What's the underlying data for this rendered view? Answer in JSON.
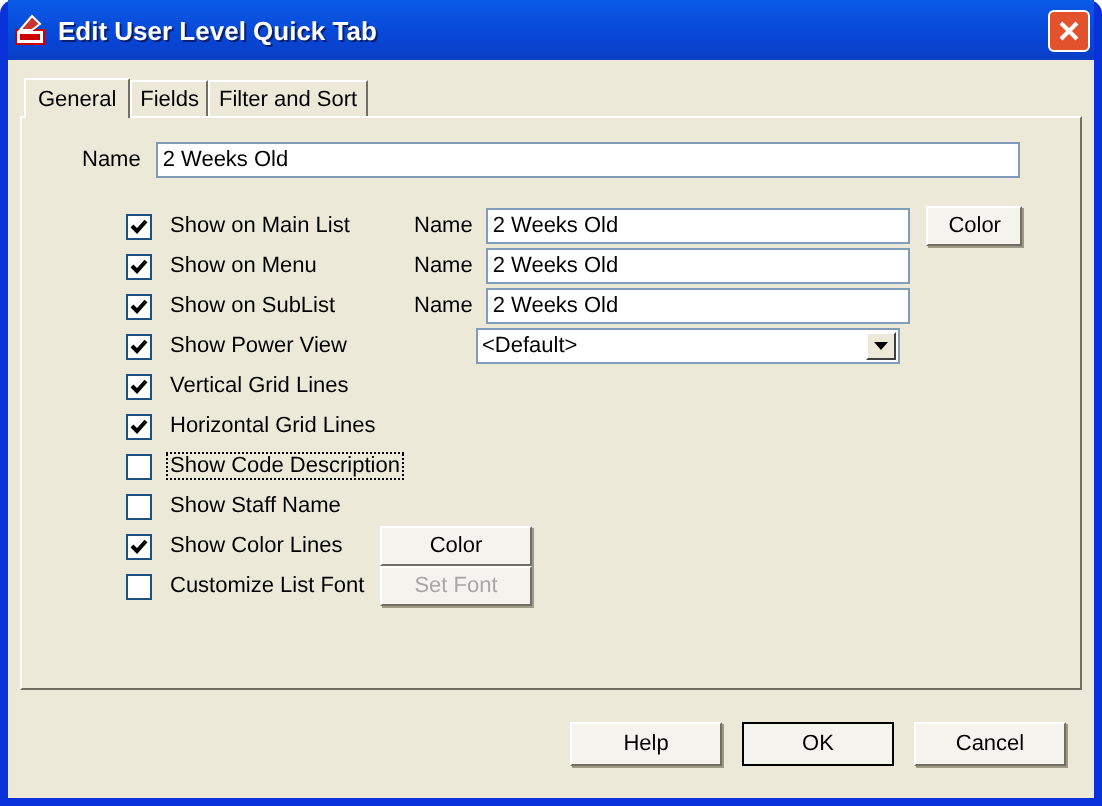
{
  "window": {
    "title": "Edit User Level Quick Tab"
  },
  "tabs": [
    {
      "label": "General",
      "selected": true
    },
    {
      "label": "Fields",
      "selected": false
    },
    {
      "label": "Filter and Sort",
      "selected": false
    }
  ],
  "name_field": {
    "label": "Name",
    "value": "2 Weeks Old"
  },
  "color_button": {
    "label": "Color",
    "disabled": false
  },
  "options": [
    {
      "label": "Show on Main List",
      "checked": true,
      "focused": false,
      "extra": {
        "kind": "name",
        "label": "Name",
        "value": "2 Weeks Old"
      }
    },
    {
      "label": "Show on Menu",
      "checked": true,
      "focused": false,
      "extra": {
        "kind": "name",
        "label": "Name",
        "value": "2 Weeks Old"
      }
    },
    {
      "label": "Show on SubList",
      "checked": true,
      "focused": false,
      "extra": {
        "kind": "name",
        "label": "Name",
        "value": "2 Weeks Old"
      }
    },
    {
      "label": "Show Power View",
      "checked": true,
      "focused": false,
      "extra": {
        "kind": "dropdown",
        "value": "<Default>"
      }
    },
    {
      "label": "Vertical Grid Lines",
      "checked": true,
      "focused": false
    },
    {
      "label": "Horizontal Grid Lines",
      "checked": true,
      "focused": false
    },
    {
      "label": "Show Code Description",
      "checked": false,
      "focused": true
    },
    {
      "label": "Show Staff Name",
      "checked": false,
      "focused": false
    },
    {
      "label": "Show Color Lines",
      "checked": true,
      "focused": false,
      "extra": {
        "kind": "button",
        "label": "Color",
        "disabled": false
      }
    },
    {
      "label": "Customize List Font",
      "checked": false,
      "focused": false,
      "extra": {
        "kind": "button",
        "label": "Set Font",
        "disabled": true
      }
    }
  ],
  "buttons": [
    {
      "label": "Help",
      "default": false
    },
    {
      "label": "OK",
      "default": true
    },
    {
      "label": "Cancel",
      "default": false
    }
  ]
}
